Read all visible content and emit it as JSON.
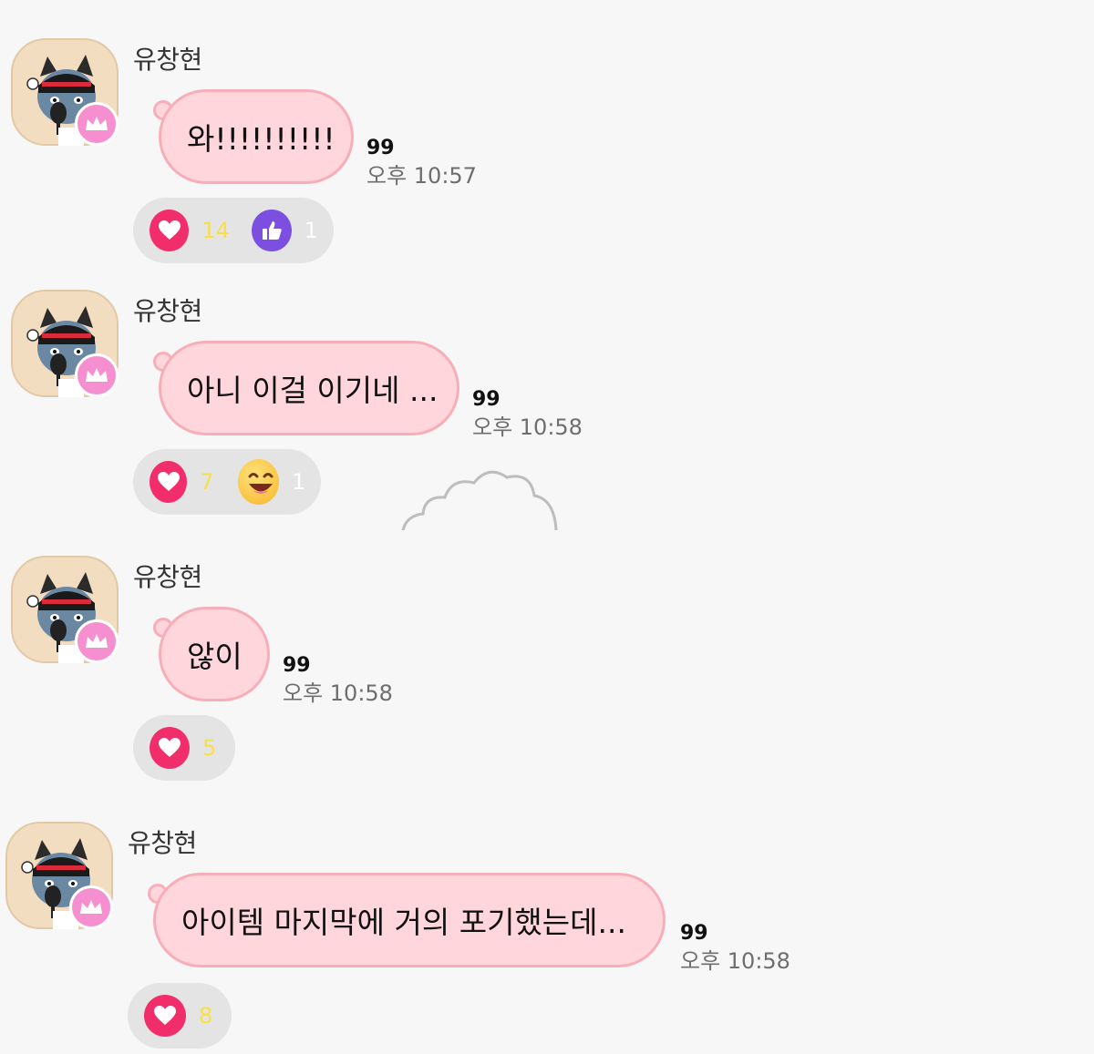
{
  "messages": [
    {
      "sender": "유창현",
      "text": "와!!!!!!!!!!",
      "read_count": "99",
      "time": "오후 10:57",
      "reactions": [
        {
          "icon": "heart-icon",
          "count": "14"
        },
        {
          "icon": "thumbs-up-icon",
          "count": "1"
        }
      ]
    },
    {
      "sender": "유창현",
      "text": "아니 이걸 이기네 ...",
      "read_count": "99",
      "time": "오후 10:58",
      "reactions": [
        {
          "icon": "heart-icon",
          "count": "7"
        },
        {
          "icon": "laughing-emoji-icon",
          "count": "1"
        }
      ]
    },
    {
      "sender": "유창현",
      "text": "않이",
      "read_count": "99",
      "time": "오후 10:58",
      "reactions": [
        {
          "icon": "heart-icon",
          "count": "5"
        }
      ]
    },
    {
      "sender": "유창현",
      "text": "아이템 마지막에 거의 포기했는데...",
      "read_count": "99",
      "time": "오후 10:58",
      "reactions": [
        {
          "icon": "heart-icon",
          "count": "8"
        }
      ]
    }
  ],
  "colors": {
    "bubble_fill": "#ffd6dc",
    "bubble_border": "#f8aeb9",
    "heart": "#f22d6b",
    "thumb": "#7d4fe0",
    "crown_badge": "#f58fd0",
    "reaction_count_yellow": "#f6e04b"
  }
}
